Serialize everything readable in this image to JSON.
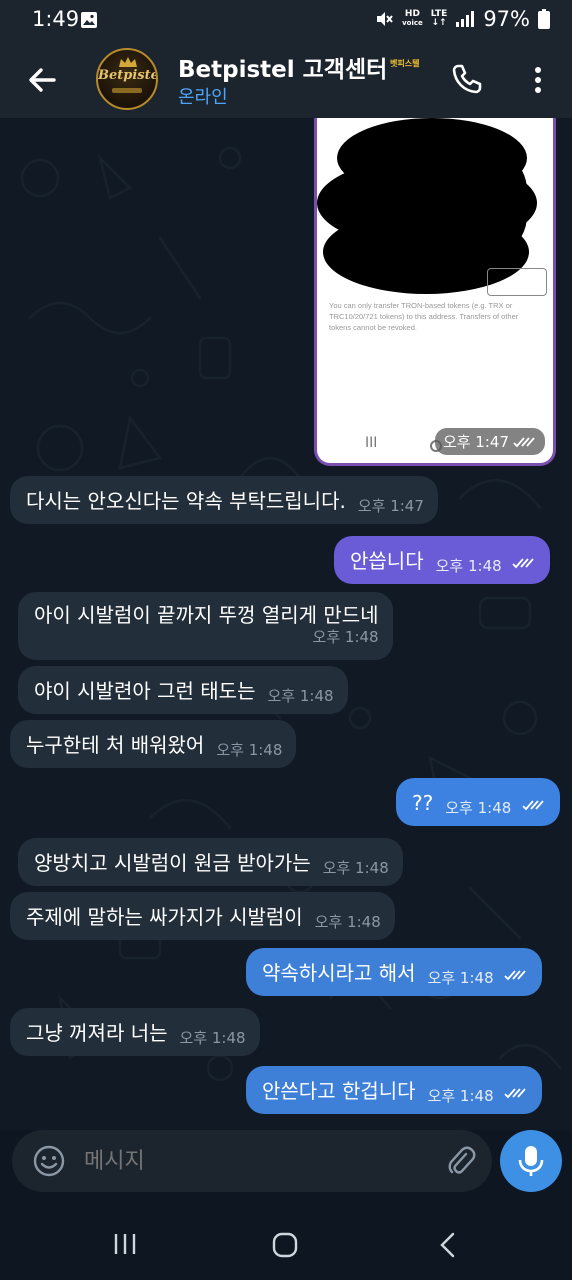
{
  "status_bar": {
    "time": "1:49",
    "network_label_1": "HD",
    "network_label_2": "voice",
    "network_label_3": "LTE",
    "battery": "97%"
  },
  "header": {
    "avatar_text": "Betpistel",
    "title": "Betpistel 고객센터",
    "title_badge": "벳피스텔",
    "subtitle": "온라인"
  },
  "image_message": {
    "caption": "You can only transfer TRON-based tokens (e.g. TRX or TRC10/20/721 tokens) to this address. Transfers of other tokens cannot be revoked.",
    "nav_glyph": "III",
    "time": "오후 1:47"
  },
  "messages": [
    {
      "side": "in",
      "text": "다시는 안오신다는 약속 부탁드립니다.",
      "time": "오후 1:47"
    },
    {
      "side": "out",
      "text": "안씁니다",
      "time": "오후 1:48"
    },
    {
      "side": "in",
      "text": "아이 시발럼이 끝까지 뚜껑 열리게 만드네",
      "time": "오후 1:48"
    },
    {
      "side": "in",
      "text": "야이 시발련아 그런 태도는",
      "time": "오후 1:48"
    },
    {
      "side": "in",
      "text": "누구한테 처 배워왔어",
      "time": "오후 1:48"
    },
    {
      "side": "out",
      "text": "??",
      "time": "오후 1:48"
    },
    {
      "side": "in",
      "text": "양방치고 시발럼이 원금 받아가는",
      "time": "오후 1:48"
    },
    {
      "side": "in",
      "text": "주제에 말하는 싸가지가 시발럼이",
      "time": "오후 1:48"
    },
    {
      "side": "out",
      "text": "약속하시라고 해서",
      "time": "오후 1:48"
    },
    {
      "side": "in",
      "text": "그냥 꺼져라 너는",
      "time": "오후 1:48"
    },
    {
      "side": "out",
      "text": "안쓴다고 한겁니다",
      "time": "오후 1:48"
    }
  ],
  "input": {
    "placeholder": "메시지"
  },
  "colors": {
    "chat_bg": "#111a24",
    "header_bg": "#1c242e",
    "incoming_bubble": "#222e3a",
    "outgoing_bubble": "#3e7fd8",
    "online_text": "#4ea4f6"
  }
}
